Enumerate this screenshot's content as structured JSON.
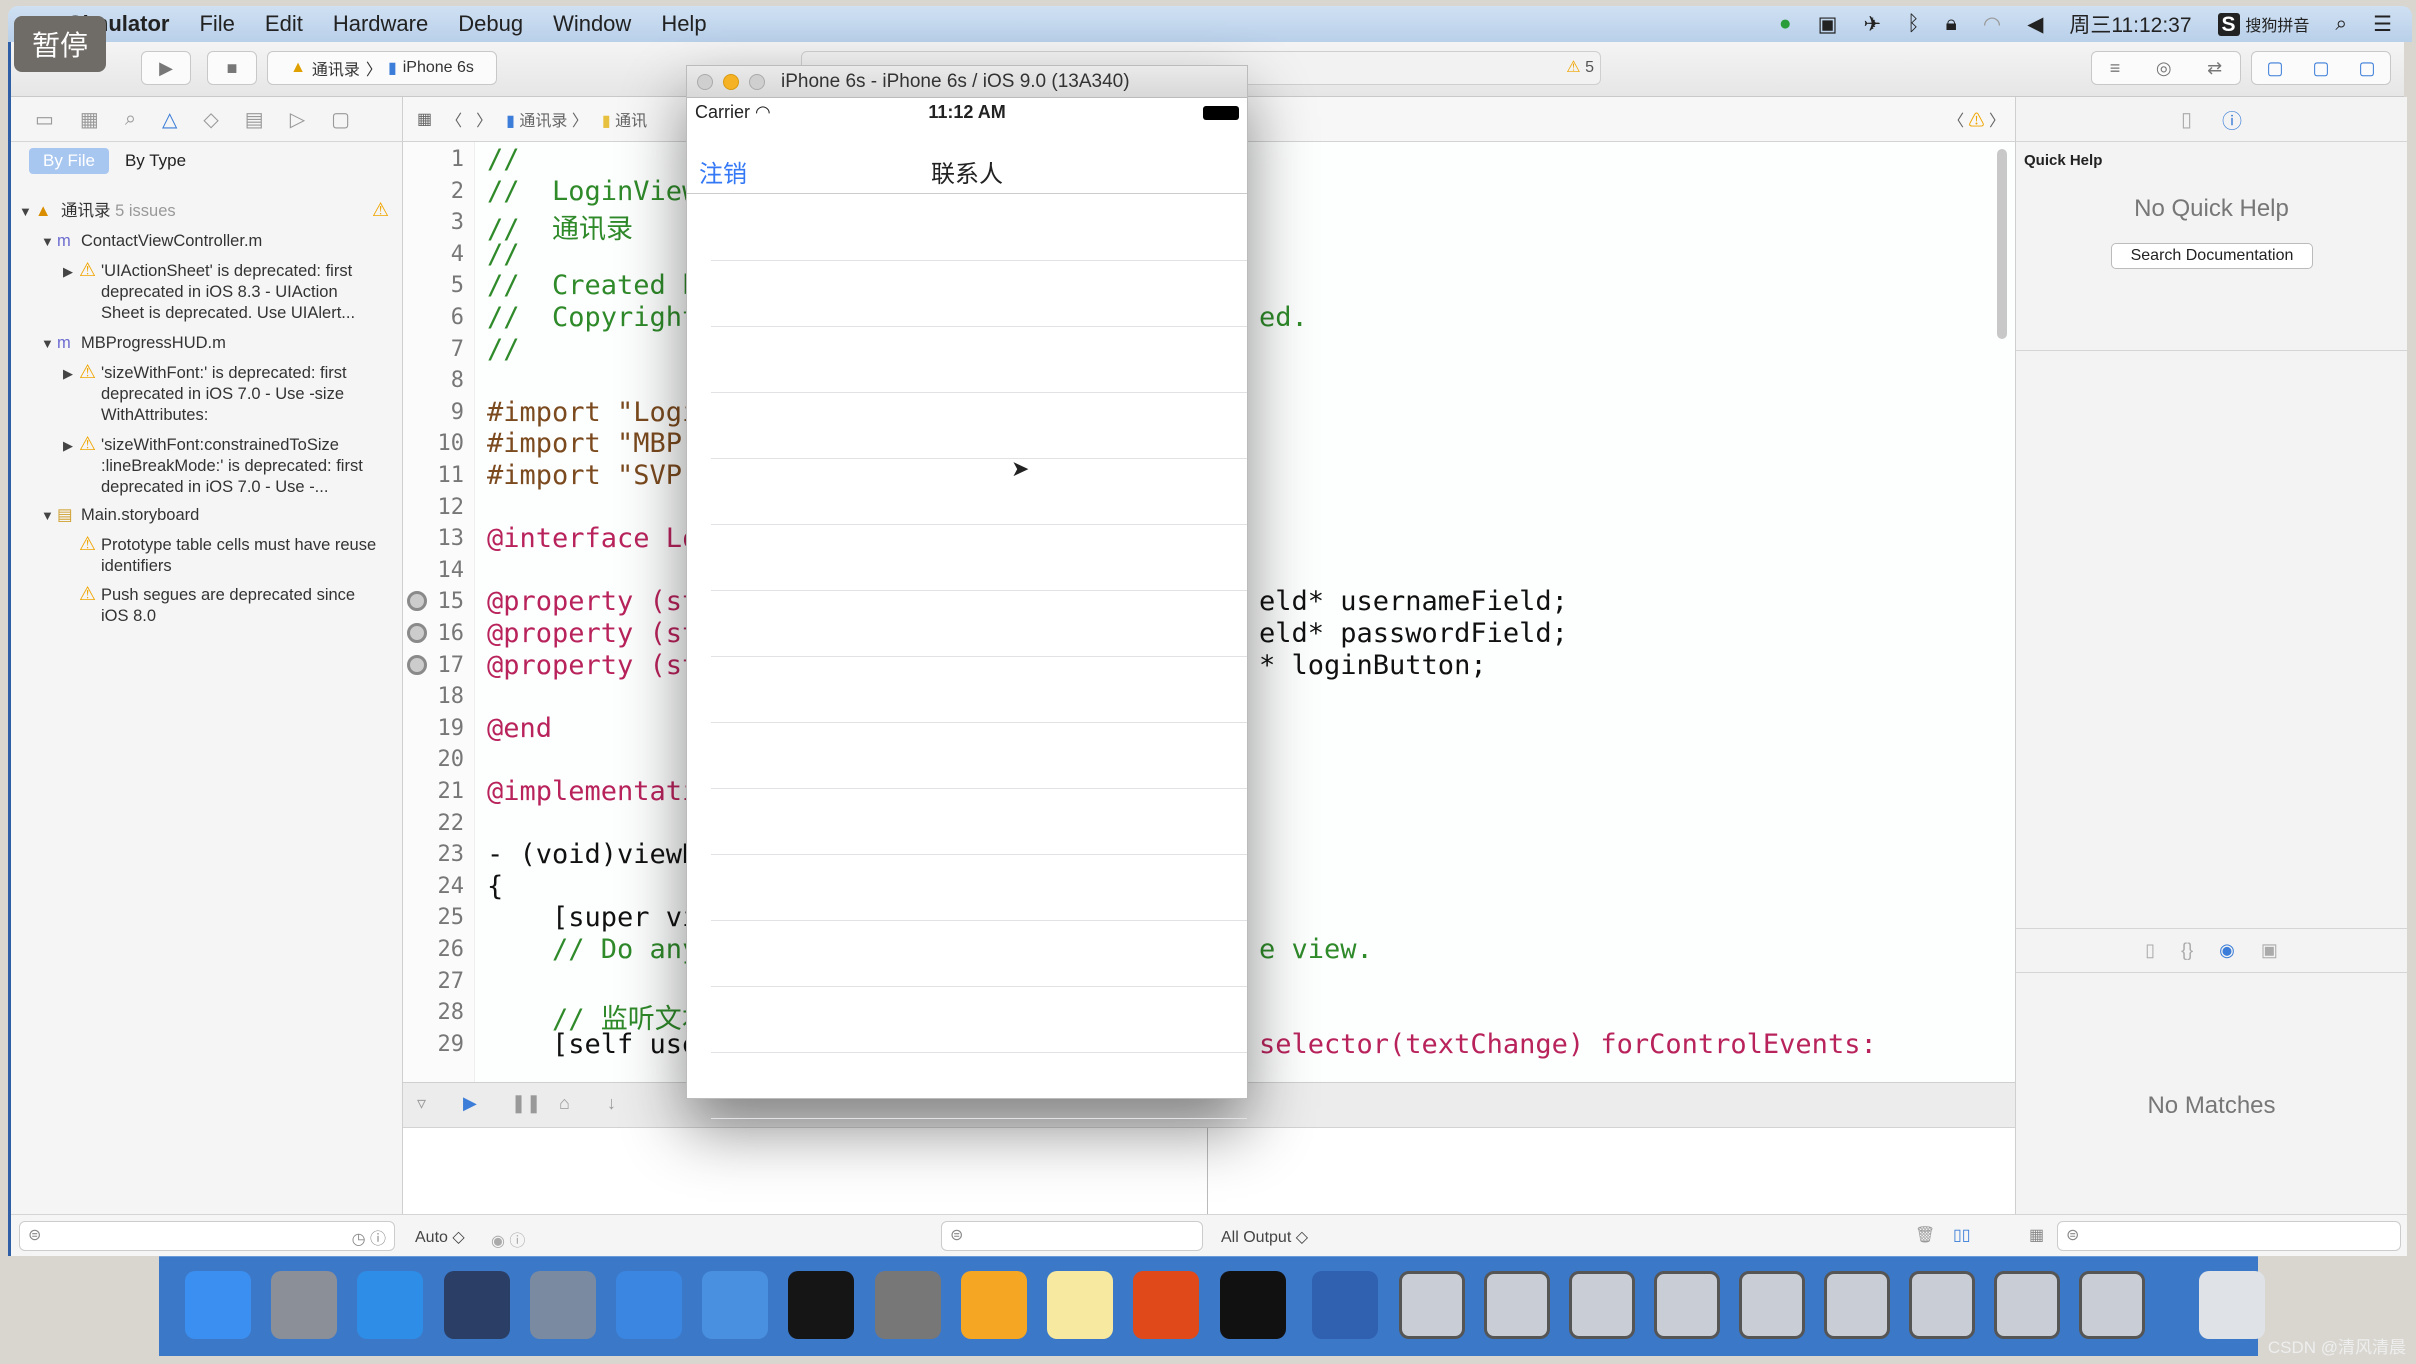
{
  "menubar": {
    "app": "Simulator",
    "items": [
      "File",
      "Edit",
      "Hardware",
      "Debug",
      "Window",
      "Help"
    ],
    "clock": "周三11:12:37",
    "ime": "搜狗拼音"
  },
  "overlay": {
    "pause": "暂停"
  },
  "toolbar": {
    "scheme": "通讯录",
    "device": "iPhone 6s",
    "warnings": "5"
  },
  "navigator": {
    "scope": [
      "By File",
      "By Type"
    ],
    "project": "通讯录",
    "issues": "5 issues",
    "files": [
      {
        "name": "ContactViewController.m",
        "issues": [
          "'UIActionSheet' is deprecated: first deprecated in iOS 8.3 - UIAction Sheet is deprecated. Use UIAlert..."
        ]
      },
      {
        "name": "MBProgressHUD.m",
        "issues": [
          "'sizeWithFont:' is deprecated: first deprecated in iOS 7.0 - Use -size WithAttributes:",
          "'sizeWithFont:constrainedToSize :lineBreakMode:' is deprecated: first deprecated in iOS 7.0 - Use -..."
        ]
      },
      {
        "name": "Main.storyboard",
        "issues": [
          "Prototype table cells must have reuse identifiers",
          "Push segues are deprecated since iOS 8.0"
        ]
      }
    ]
  },
  "editor": {
    "jumpbar": [
      "通讯录",
      "通讯"
    ],
    "lines": [
      {
        "n": "1",
        "l": "//",
        "c": "cm"
      },
      {
        "n": "2",
        "l": "//  LoginView",
        "c": "cm"
      },
      {
        "n": "3",
        "l": "//  通讯录",
        "c": "cm"
      },
      {
        "n": "4",
        "l": "//",
        "c": "cm"
      },
      {
        "n": "5",
        "l": "//  Created b",
        "c": "cm"
      },
      {
        "n": "6",
        "l": "//  Copyright",
        "c": "cm",
        "r": "ed."
      },
      {
        "n": "7",
        "l": "//",
        "c": "cm"
      },
      {
        "n": "8",
        "l": ""
      },
      {
        "n": "9",
        "l": "#import \"Logi",
        "c": "pp"
      },
      {
        "n": "10",
        "l": "#import \"MBPr",
        "c": "pp"
      },
      {
        "n": "11",
        "l": "#import \"SVPr",
        "c": "pp"
      },
      {
        "n": "12",
        "l": ""
      },
      {
        "n": "13",
        "l": "@interface Lo",
        "c": "kw"
      },
      {
        "n": "14",
        "l": ""
      },
      {
        "n": "15",
        "l": "@property (st",
        "c": "kw",
        "r": "eld* usernameField;"
      },
      {
        "n": "16",
        "l": "@property (st",
        "c": "kw",
        "r": "eld* passwordField;"
      },
      {
        "n": "17",
        "l": "@property (st",
        "c": "kw",
        "r": "* loginButton;"
      },
      {
        "n": "18",
        "l": ""
      },
      {
        "n": "19",
        "l": "@end",
        "c": "kw"
      },
      {
        "n": "20",
        "l": ""
      },
      {
        "n": "21",
        "l": "@implementati",
        "c": "kw"
      },
      {
        "n": "22",
        "l": ""
      },
      {
        "n": "23",
        "l": "- (void)viewD"
      },
      {
        "n": "24",
        "l": "{"
      },
      {
        "n": "25",
        "l": "    [super vi"
      },
      {
        "n": "26",
        "l": "    // Do any",
        "c": "cm",
        "r": "e view."
      },
      {
        "n": "27",
        "l": ""
      },
      {
        "n": "28",
        "l": "    // 监听文本",
        "c": "cm"
      },
      {
        "n": "29",
        "l": "    [self use",
        "r": "selector(textChange) forControlEvents:"
      }
    ]
  },
  "debug": {
    "auto": "Auto ◇",
    "output": "All Output ◇"
  },
  "utilities": {
    "title": "Quick Help",
    "empty": "No Quick Help",
    "search_btn": "Search Documentation",
    "no_matches": "No Matches"
  },
  "simulator": {
    "title": "iPhone 6s - iPhone 6s / iOS 9.0 (13A340)",
    "carrier": "Carrier",
    "time": "11:12 AM",
    "left_btn": "注销",
    "nav_title": "联系人",
    "accent": "#3478f6"
  },
  "watermark": "CSDN @清风清晨"
}
